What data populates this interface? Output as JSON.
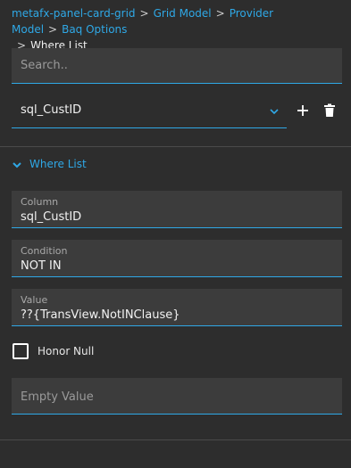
{
  "breadcrumb": {
    "items": [
      "metafx-panel-card-grid",
      "Grid Model",
      "Provider Model",
      "Baq Options"
    ],
    "separator": ">",
    "current": "Where List"
  },
  "search": {
    "placeholder": "Search.."
  },
  "selector": {
    "value": "sql_CustID"
  },
  "section": {
    "title": "Where List"
  },
  "fields": {
    "column": {
      "label": "Column",
      "value": "sql_CustID"
    },
    "condition": {
      "label": "Condition",
      "value": "NOT IN"
    },
    "value": {
      "label": "Value",
      "value": "??{TransView.NotINClause}"
    }
  },
  "honor_null": {
    "label": "Honor Null",
    "checked": false
  },
  "empty_value": {
    "placeholder": "Empty Value"
  },
  "icons": {
    "add": "plus-icon",
    "delete": "trash-icon",
    "dropdown": "chevron-down-icon",
    "collapse": "chevron-down-icon"
  },
  "colors": {
    "background": "#2d2d2d",
    "field_background": "#3c3c3c",
    "accent": "#2fa8e6",
    "text": "#e6e6e6",
    "muted": "#9a9a9a"
  }
}
